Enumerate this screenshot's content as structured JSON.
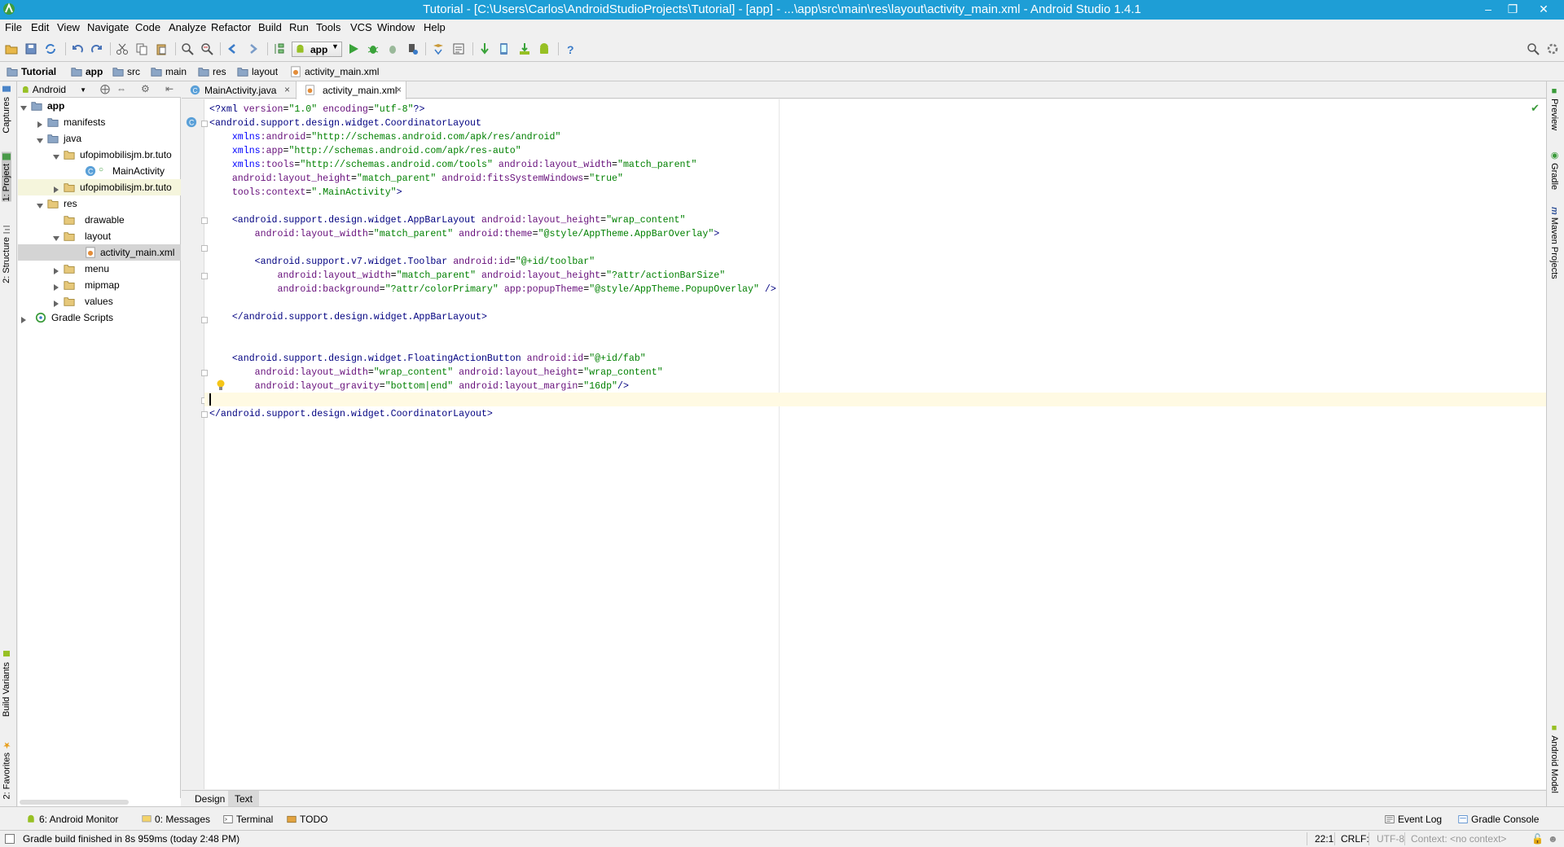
{
  "window": {
    "title": "Tutorial - [C:\\Users\\Carlos\\AndroidStudioProjects\\Tutorial] - [app] - ...\\app\\src\\main\\res\\layout\\activity_main.xml - Android Studio 1.4.1"
  },
  "menu": [
    "File",
    "Edit",
    "View",
    "Navigate",
    "Code",
    "Analyze",
    "Refactor",
    "Build",
    "Run",
    "Tools",
    "VCS",
    "Window",
    "Help"
  ],
  "toolbar": {
    "run_config": "app"
  },
  "breadcrumbs": [
    "Tutorial",
    "app",
    "src",
    "main",
    "res",
    "layout",
    "activity_main.xml"
  ],
  "left_tool_tabs": [
    "Captures",
    "1: Project",
    "2: Structure",
    "Build Variants",
    "2: Favorites"
  ],
  "right_tool_tabs": [
    "Preview",
    "Gradle",
    "Maven Projects",
    "Android Model"
  ],
  "project_panel": {
    "view_selector": "Android",
    "tree": [
      {
        "label": "app",
        "bold": true
      },
      {
        "label": "manifests"
      },
      {
        "label": "java"
      },
      {
        "label": "ufopimobilisjm.br.tuto"
      },
      {
        "label": "MainActivity"
      },
      {
        "label": "ufopimobilisjm.br.tuto"
      },
      {
        "label": "res"
      },
      {
        "label": "drawable"
      },
      {
        "label": "layout"
      },
      {
        "label": "activity_main.xml"
      },
      {
        "label": "menu"
      },
      {
        "label": "mipmap"
      },
      {
        "label": "values"
      },
      {
        "label": "Gradle Scripts"
      }
    ]
  },
  "editor_tabs": [
    {
      "label": "MainActivity.java",
      "active": false
    },
    {
      "label": "activity_main.xml",
      "active": true
    }
  ],
  "code_lines": [
    "<?xml version=\"1.0\" encoding=\"utf-8\"?>",
    "<android.support.design.widget.CoordinatorLayout",
    "    xmlns:android=\"http://schemas.android.com/apk/res/android\"",
    "    xmlns:app=\"http://schemas.android.com/apk/res-auto\"",
    "    xmlns:tools=\"http://schemas.android.com/tools\" android:layout_width=\"match_parent\"",
    "    android:layout_height=\"match_parent\" android:fitsSystemWindows=\"true\"",
    "    tools:context=\".MainActivity\">",
    "",
    "    <android.support.design.widget.AppBarLayout android:layout_height=\"wrap_content\"",
    "        android:layout_width=\"match_parent\" android:theme=\"@style/AppTheme.AppBarOverlay\">",
    "",
    "        <android.support.v7.widget.Toolbar android:id=\"@+id/toolbar\"",
    "            android:layout_width=\"match_parent\" android:layout_height=\"?attr/actionBarSize\"",
    "            android:background=\"?attr/colorPrimary\" app:popupTheme=\"@style/AppTheme.PopupOverlay\" />",
    "",
    "    </android.support.design.widget.AppBarLayout>",
    "",
    "",
    "    <android.support.design.widget.FloatingActionButton android:id=\"@+id/fab\"",
    "        android:layout_width=\"wrap_content\" android:layout_height=\"wrap_content\"",
    "        android:layout_gravity=\"bottom|end\" android:layout_margin=\"16dp\"/>",
    "",
    "</android.support.design.widget.CoordinatorLayout>"
  ],
  "design_tabs": {
    "design": "Design",
    "text": "Text"
  },
  "bottom_tools": {
    "android_monitor": "6: Android Monitor",
    "messages": "0: Messages",
    "terminal": "Terminal",
    "todo": "TODO",
    "event_log": "Event Log",
    "gradle_console": "Gradle Console"
  },
  "status": {
    "message": "Gradle build finished in 8s 959ms (today 2:48 PM)",
    "position": "22:1",
    "line_sep": "CRLF:",
    "encoding": "UTF-8",
    "context": "Context: <no context>"
  },
  "colors": {
    "titlebar": "#1e9ed6",
    "tag": "#000080",
    "attribute": "#660e7a",
    "value": "#008000",
    "current_line": "#fffae3"
  }
}
